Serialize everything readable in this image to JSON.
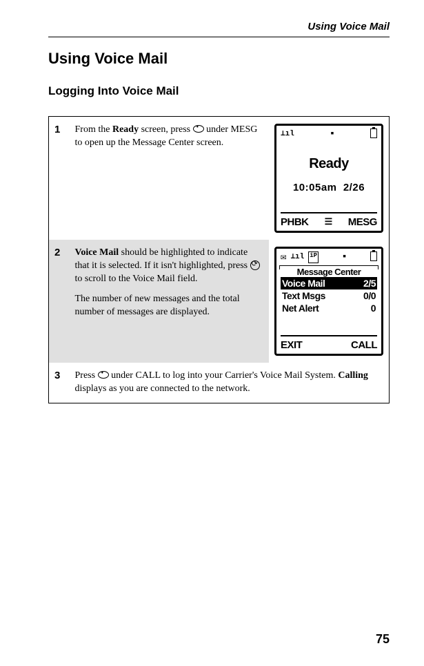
{
  "header": {
    "running_head": "Using Voice Mail"
  },
  "title": "Using Voice Mail",
  "subtitle": "Logging Into Voice Mail",
  "steps": {
    "s1": {
      "num": "1",
      "pre": "From the ",
      "bold1": "Ready",
      "mid": " screen, press ",
      "post": " under MESG to open up the Message Center screen."
    },
    "s2": {
      "num": "2",
      "boldA": "Voice Mail",
      "textA": " should be highlighted to indicate that it is selected. If it isn't highlighted, press ",
      "textB": " to scroll to the Voice Mail field.",
      "para2": "The number of new messages and the total number of messages are displayed."
    },
    "s3": {
      "num": "3",
      "pre": "Press ",
      "mid": " under CALL to log into your Carrier's Voice Mail System. ",
      "bold": "Calling",
      "post": " displays as you are connected to the network."
    }
  },
  "screen1": {
    "signal_icon": "⊥ıl",
    "indicator": "▪",
    "ready": "Ready",
    "time": "10:05am",
    "date": "2/26",
    "soft_left": "PHBK",
    "soft_mid": "☰",
    "soft_right": "MESG"
  },
  "screen2": {
    "mail_icon": "✉",
    "sig_icon": "⊥ıl",
    "ip_icon": "iP",
    "ind": "▪",
    "title": "Message Center",
    "row1_label": "Voice Mail",
    "row1_val": "2/5",
    "row2_label": "Text Msgs",
    "row2_val": "0/0",
    "row3_label": "Net Alert",
    "row3_val": "0",
    "soft_left": "EXIT",
    "soft_right": "CALL"
  },
  "page_number": "75"
}
